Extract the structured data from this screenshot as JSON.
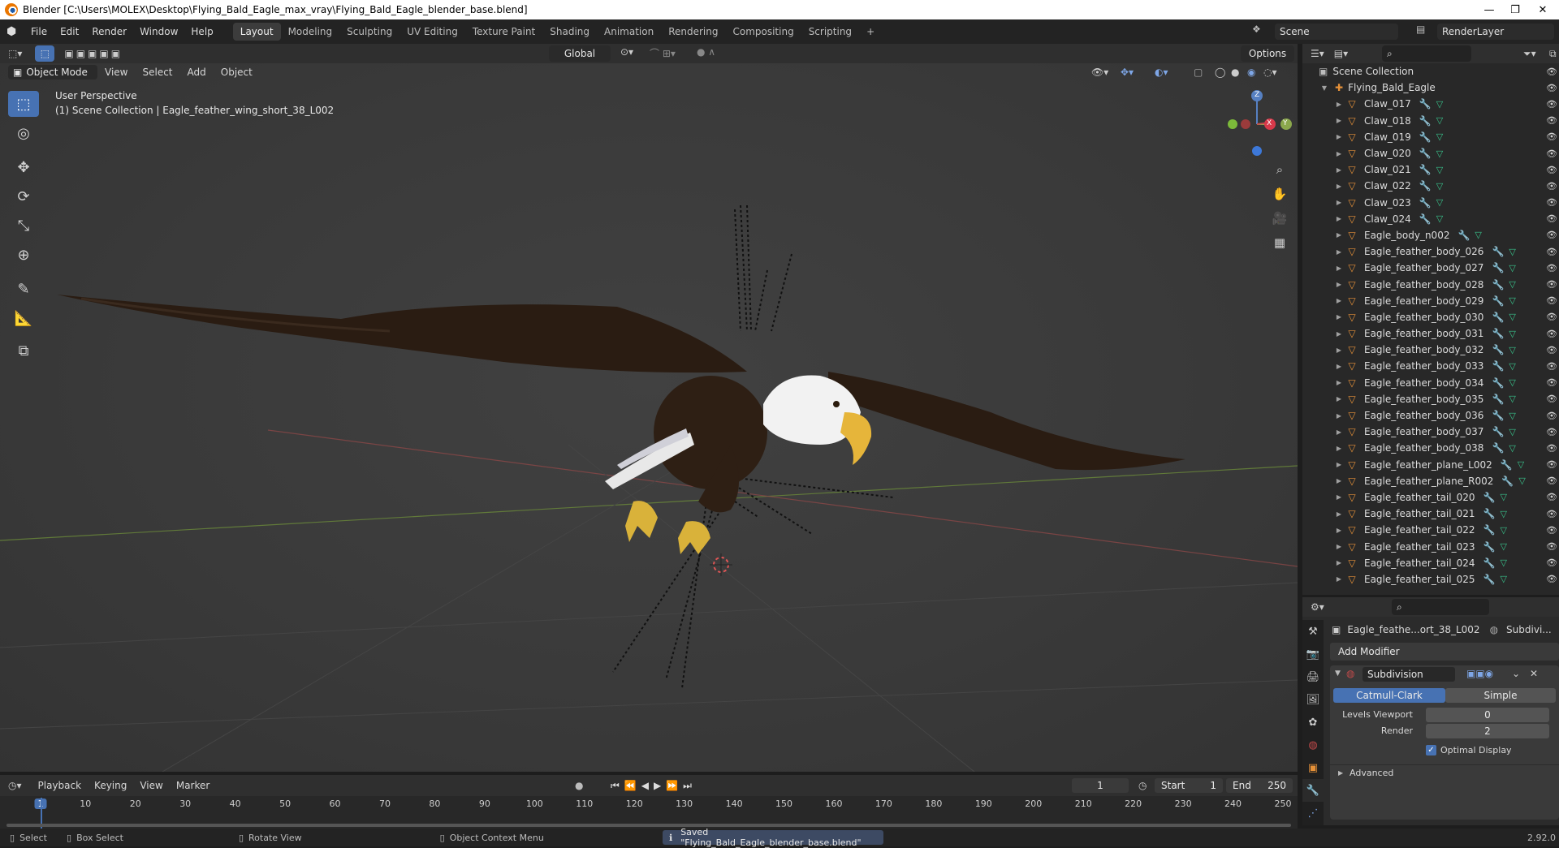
{
  "window": {
    "title": "Blender [C:\\Users\\MOLEX\\Desktop\\Flying_Bald_Eagle_max_vray\\Flying_Bald_Eagle_blender_base.blend]",
    "minimize": "—",
    "maximize": "❐",
    "close": "✕"
  },
  "menu": [
    "File",
    "Edit",
    "Render",
    "Window",
    "Help"
  ],
  "workspaces": [
    "Layout",
    "Modeling",
    "Sculpting",
    "UV Editing",
    "Texture Paint",
    "Shading",
    "Animation",
    "Rendering",
    "Compositing",
    "Scripting"
  ],
  "workspace_add": "+",
  "scene": {
    "name": "Scene",
    "render_layer": "RenderLayer"
  },
  "viewport_header": {
    "mode": "Object Mode",
    "menus": [
      "View",
      "Select",
      "Add",
      "Object"
    ],
    "orientation": "Global",
    "options": "Options"
  },
  "viewport": {
    "perspective": "User Perspective",
    "collection_info": "(1) Scene Collection | Eagle_feather_wing_short_38_L002",
    "axes": {
      "x": "X",
      "y": "Y",
      "z": "Z"
    }
  },
  "outliner": {
    "root": "Scene Collection",
    "collection": "Flying_Bald_Eagle",
    "items": [
      "Claw_017",
      "Claw_018",
      "Claw_019",
      "Claw_020",
      "Claw_021",
      "Claw_022",
      "Claw_023",
      "Claw_024",
      "Eagle_body_n002",
      "Eagle_feather_body_026",
      "Eagle_feather_body_027",
      "Eagle_feather_body_028",
      "Eagle_feather_body_029",
      "Eagle_feather_body_030",
      "Eagle_feather_body_031",
      "Eagle_feather_body_032",
      "Eagle_feather_body_033",
      "Eagle_feather_body_034",
      "Eagle_feather_body_035",
      "Eagle_feather_body_036",
      "Eagle_feather_body_037",
      "Eagle_feather_body_038",
      "Eagle_feather_plane_L002",
      "Eagle_feather_plane_R002",
      "Eagle_feather_tail_020",
      "Eagle_feather_tail_021",
      "Eagle_feather_tail_022",
      "Eagle_feather_tail_023",
      "Eagle_feather_tail_024",
      "Eagle_feather_tail_025"
    ]
  },
  "properties": {
    "object": "Eagle_feathe...ort_38_L002",
    "modifier_crumb": "Subdivi...",
    "add_modifier": "Add Modifier",
    "modifier_name": "Subdivision",
    "type_a": "Catmull-Clark",
    "type_b": "Simple",
    "levels_viewport_label": "Levels Viewport",
    "levels_viewport_value": "0",
    "render_label": "Render",
    "render_value": "2",
    "optimal_display": "Optimal Display",
    "advanced": "Advanced"
  },
  "timeline": {
    "menus": [
      "Playback",
      "Keying",
      "View",
      "Marker"
    ],
    "current_frame": "1",
    "start_label": "Start",
    "start": "1",
    "end_label": "End",
    "end": "250",
    "ticks": [
      "1",
      "10",
      "20",
      "30",
      "40",
      "50",
      "60",
      "70",
      "80",
      "90",
      "100",
      "110",
      "120",
      "130",
      "140",
      "150",
      "160",
      "170",
      "180",
      "190",
      "200",
      "210",
      "220",
      "230",
      "240",
      "250"
    ]
  },
  "status": {
    "select": "Select",
    "box_select": "Box Select",
    "rotate_view": "Rotate View",
    "context_menu": "Object Context Menu",
    "message": "Saved \"Flying_Bald_Eagle_blender_base.blend\"",
    "version": "2.92.0"
  },
  "colors": {
    "accent": "#4772b3",
    "object_orange": "#e69138",
    "mesh_green": "#38c38b",
    "modifier_blue": "#7ea6e6"
  }
}
